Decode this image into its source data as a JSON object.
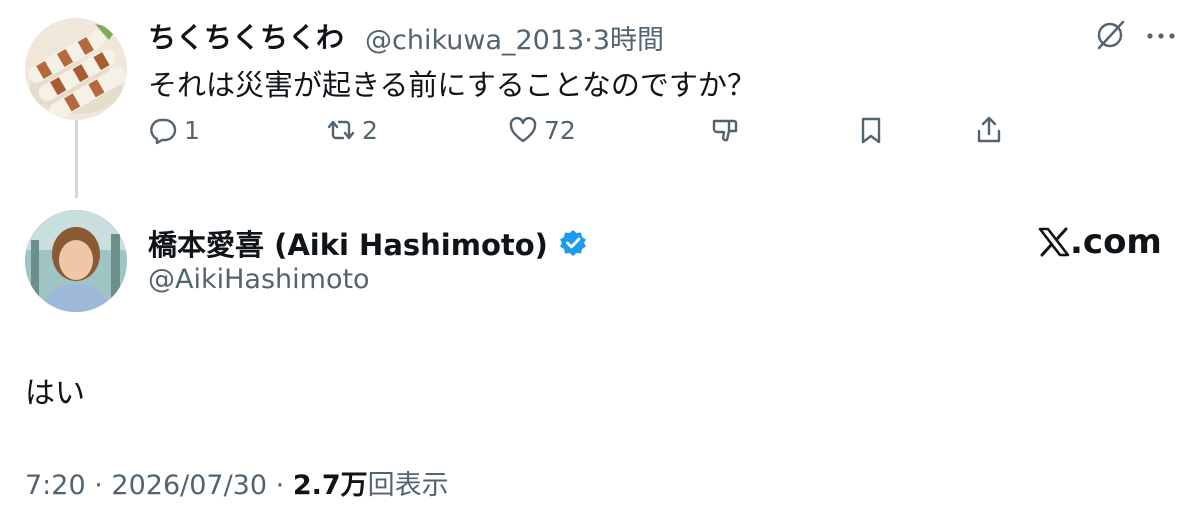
{
  "reply": {
    "author_name": "ちくちくちくわ",
    "handle": "@chikuwa_2013",
    "separator": "·",
    "time": "3時間",
    "text": "それは災害が起きる前にすることなのですか？",
    "actions": {
      "reply_count": "1",
      "repost_count": "2",
      "like_count": "72",
      "dislike_count": "",
      "bookmark_count": "",
      "share_count": ""
    }
  },
  "main_post": {
    "author_name": "橋本愛喜 (Aiki Hashimoto)",
    "handle": "@AikiHashimoto",
    "site_logo_suffix": ".com",
    "text": "はい",
    "time": "7:20",
    "date": "2026/07/30",
    "separator": "·",
    "views_number": "2.7万",
    "views_label": "回表示"
  },
  "colors": {
    "text": "#0f1419",
    "secondary": "#536471",
    "verified": "#1d9bf0",
    "thread_line": "#cfd9de"
  }
}
